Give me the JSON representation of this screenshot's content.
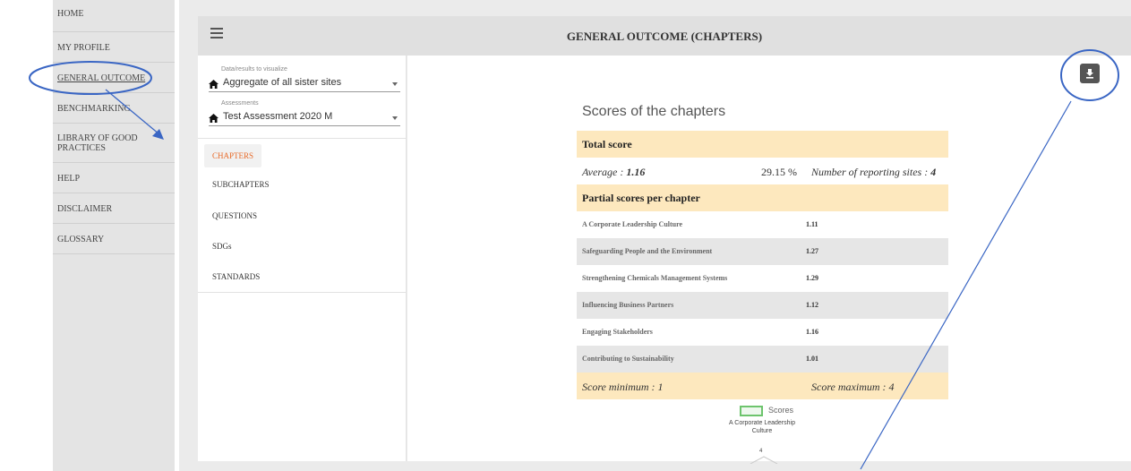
{
  "sidebar": {
    "items": [
      {
        "label": "HOME"
      },
      {
        "label": "MY PROFILE"
      },
      {
        "label": "GENERAL OUTCOME"
      },
      {
        "label": "BENCHMARKING"
      },
      {
        "label": "LIBRARY OF GOOD PRACTICES"
      },
      {
        "label": "HELP"
      },
      {
        "label": "DISCLAIMER"
      },
      {
        "label": "GLOSSARY"
      }
    ]
  },
  "header": {
    "title": "GENERAL OUTCOME (CHAPTERS)"
  },
  "filters": {
    "data": {
      "label": "Data/results to visualize",
      "value": "Aggregate of all sister sites"
    },
    "assessment": {
      "label": "Assessments",
      "value": "Test Assessment 2020 M"
    }
  },
  "views": {
    "items": [
      {
        "label": "CHAPTERS"
      },
      {
        "label": "SUBCHAPTERS"
      },
      {
        "label": "QUESTIONS"
      },
      {
        "label": "SDGs"
      },
      {
        "label": "STANDARDS"
      }
    ]
  },
  "content": {
    "title": "Scores of the chapters",
    "total_label": "Total score",
    "average_label": "Average : ",
    "average_value": "1.16",
    "percent": "29.15 %",
    "reporting_label": "Number of reporting sites : ",
    "reporting_value": "4",
    "partial_label": "Partial scores per chapter",
    "chapters": [
      {
        "name": "A Corporate Leadership Culture",
        "score": "1.11"
      },
      {
        "name": "Safeguarding People and the Environment",
        "score": "1.27"
      },
      {
        "name": "Strengthening Chemicals Management Systems",
        "score": "1.29"
      },
      {
        "name": "Influencing Business Partners",
        "score": "1.12"
      },
      {
        "name": "Engaging Stakeholders",
        "score": "1.16"
      },
      {
        "name": "Contributing to Sustainability",
        "score": "1.01"
      }
    ],
    "score_min": "Score minimum : 1",
    "score_max": "Score maximum : 4"
  },
  "chart": {
    "legend": "Scores",
    "axis_label": "A Corporate Leadership Culture",
    "tick": "4"
  },
  "colors": {
    "accent": "#e86b2a",
    "band": "#fde8be",
    "annotation": "#3a66c4"
  }
}
